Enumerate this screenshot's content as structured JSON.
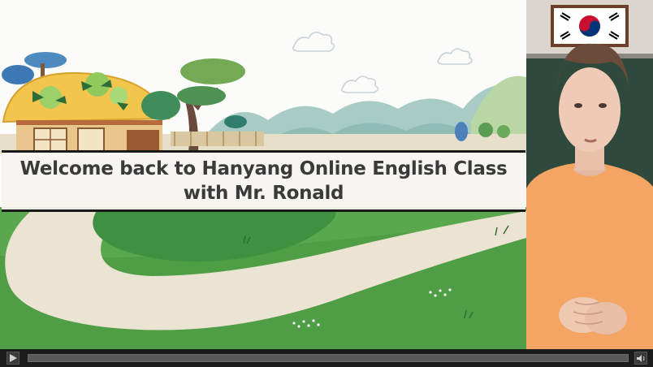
{
  "slide": {
    "title_line1": "Welcome back to Hanyang Online English Class",
    "title_line2": "with Mr. Ronald"
  },
  "webcam": {
    "flag": "south-korea-flag",
    "presenter": "presenter"
  },
  "player": {
    "play_icon": "play-icon",
    "volume_icon": "volume-icon",
    "progress": 0.0
  },
  "colors": {
    "banner_border": "#1a1a1a",
    "title_text": "#3a3a3a",
    "grass": "#4f9d45",
    "path": "#ece4d2",
    "sweater": "#f4a563",
    "chalkboard": "#2f4a3c"
  }
}
